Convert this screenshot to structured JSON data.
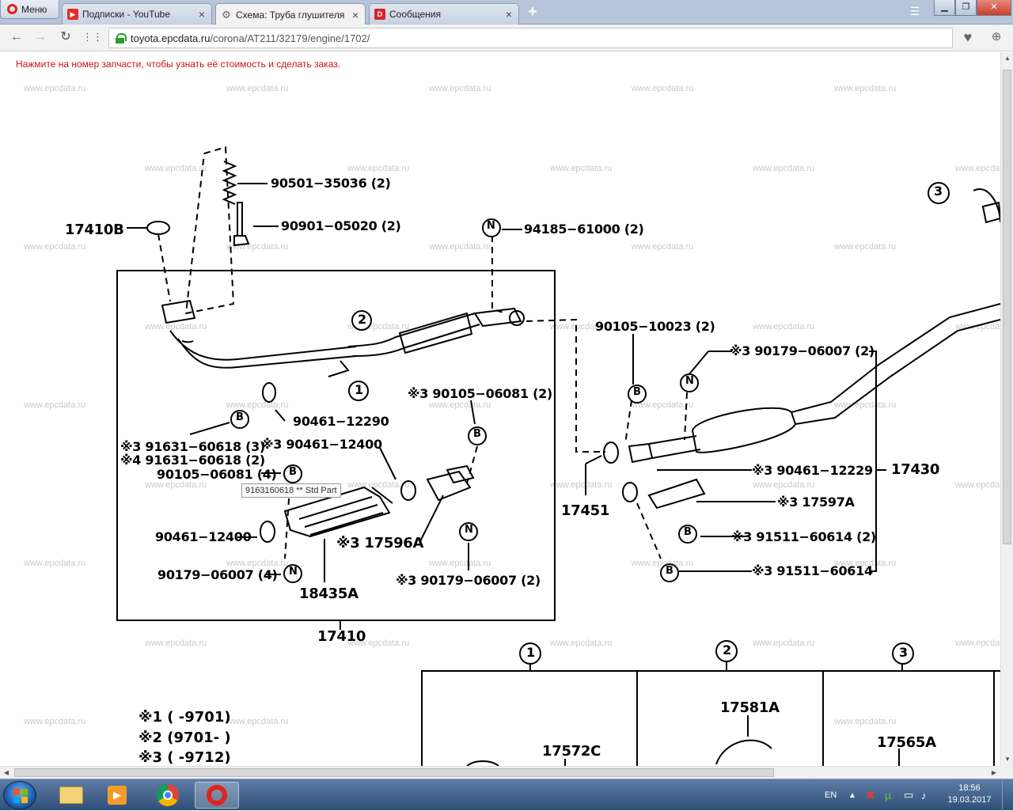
{
  "browser": {
    "menu_label": "Меню",
    "tabs": [
      {
        "title": "Подписки - YouTube",
        "icon": "youtube-icon",
        "active": false
      },
      {
        "title": "Схема: Труба глушителя и",
        "icon": "gear-icon",
        "active": true
      },
      {
        "title": "Сообщения",
        "icon": "d-icon",
        "active": false
      }
    ],
    "url_domain": "toyota.epcdata.ru",
    "url_path": "/corona/AT211/32179/engine/1702/"
  },
  "page": {
    "notice": "Нажмите на номер запчасти, чтобы узнать её стоимость и сделать заказ.",
    "watermark": "www.epcdata.ru",
    "tooltip": "9163160618 ** Std Part"
  },
  "parts": {
    "p17410B": "17410B",
    "p90501": "90501−35036 (2)",
    "p90901": "90901−05020 (2)",
    "p94185": "94185−61000 (2)",
    "p90105_10023": "90105−10023 (2)",
    "p90179_06007_r": "※3 90179−06007 (2)",
    "p90461_12290": "90461−12290",
    "p90105_06081_2": "※3 90105−06081 (2)",
    "p91631_3": "※3  91631−60618 (3)",
    "p91631_4": "※4  91631−60618 (2)",
    "p90105_06081_4": "90105−06081 (4)",
    "p90461_12400_top": "※3 90461−12400",
    "p90461_12400": "90461−12400",
    "p17596A": "※3 17596A",
    "p90179_06007_4": "90179−06007 (4)",
    "p18435A": "18435A",
    "p90179_06007_2": "※3 90179−06007 (2)",
    "p17410": "17410",
    "p17451": "17451",
    "p90461_12229": "※3 90461−12229",
    "p17430": "17430",
    "p17597A": "※3 17597A",
    "p91511_2": "※3 91511−60614 (2)",
    "p91511": "※3 91511−60614",
    "p17581A": "17581A",
    "p17572C": "17572C",
    "p17565A": "17565A"
  },
  "callouts": {
    "one": "1",
    "two": "2",
    "three": "3",
    "b": "B",
    "n": "N"
  },
  "legend": [
    "※1 (      -9701)",
    "※2 (9701-      )",
    "※3 (      -9712)"
  ],
  "taskbar": {
    "lang": "EN",
    "time": "18:56",
    "date": "19.03.2017"
  }
}
